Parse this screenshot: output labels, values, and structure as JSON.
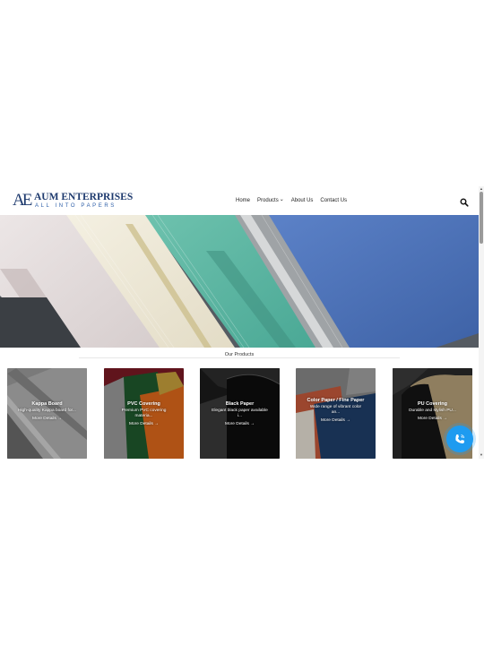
{
  "brand": {
    "mark": "AE",
    "name": "AUM ENTERPRISES",
    "tagline": "ALL INTO PAPERS"
  },
  "nav": {
    "items": [
      "Home",
      "Products",
      "About Us",
      "Contact Us"
    ],
    "products_chevron": "⌄"
  },
  "icons": {
    "search": "search-icon",
    "call": "phone-icon",
    "dropdown": "chevron-down-icon"
  },
  "section": {
    "title": "Our Products"
  },
  "products": [
    {
      "title": "Kappa Board",
      "desc": "High-quality Kappa board for...",
      "link": "More Details →"
    },
    {
      "title": "PVC Covering",
      "desc": "Premium PVC covering materia...",
      "link": "More Details →"
    },
    {
      "title": "Black Paper",
      "desc": "Elegant black paper available i...",
      "link": "More Details →"
    },
    {
      "title": "Color Paper / Fine Paper",
      "desc": "Wide range of vibrant color an...",
      "link": "More Details →"
    },
    {
      "title": "PU Covering",
      "desc": "Durable and stylish PU...",
      "link": "More Details →"
    }
  ],
  "colors": {
    "brand_navy": "#1e3a6e",
    "brand_blue": "#2e5fa8",
    "call_button": "#1e9bf0"
  }
}
